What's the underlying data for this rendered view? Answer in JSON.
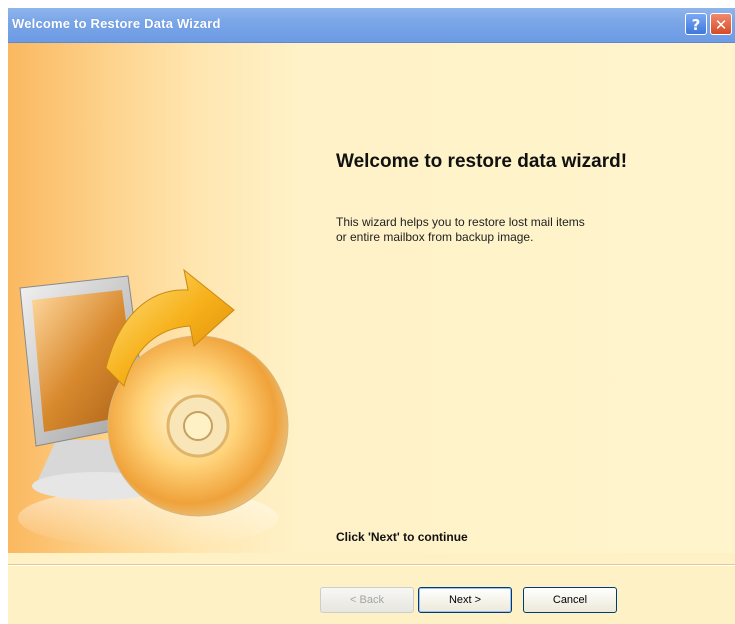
{
  "window": {
    "title": "Welcome to Restore Data Wizard",
    "help_glyph": "?",
    "close_glyph": "✕"
  },
  "content": {
    "heading": "Welcome to restore data wizard!",
    "description_line1": "This wizard helps you to restore lost mail items",
    "description_line2": "or entire mailbox from backup image.",
    "continue_hint": "Click 'Next' to continue"
  },
  "buttons": {
    "back_label": "< Back",
    "next_label": "Next >",
    "cancel_label": "Cancel"
  },
  "icons": {
    "illustration": "monitor-cd-restore-icon",
    "help": "help-icon",
    "close": "close-icon"
  },
  "colors": {
    "titlebar": "#7aa6e8",
    "background": "#fff1c6",
    "accent_orange": "#f6a53c"
  }
}
